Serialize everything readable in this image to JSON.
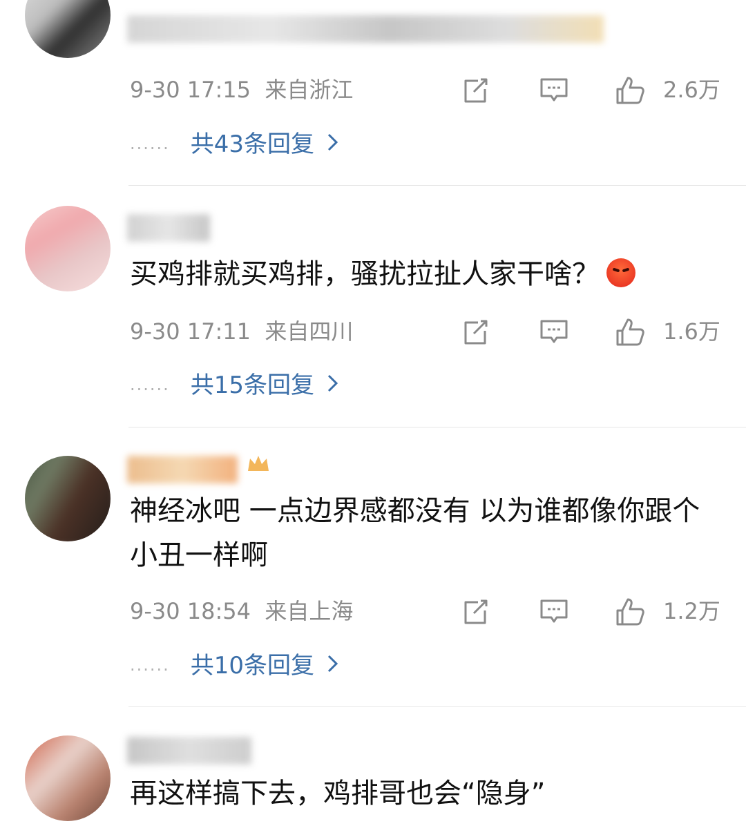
{
  "comments": [
    {
      "text": "",
      "time": "9-30 17:15",
      "location": "来自浙江",
      "likes": "2.6万",
      "replies": "共43条回复",
      "avatar_colors": [
        "#d9d9d9",
        "#9a9a9a",
        "#333333"
      ]
    },
    {
      "text": "买鸡排就买鸡排，骚扰拉扯人家干啥？",
      "time": "9-30 17:11",
      "location": "来自四川",
      "likes": "1.6万",
      "replies": "共15条回复",
      "avatar_colors": [
        "#f4b4b8",
        "#e7c7c9",
        "#f7d8d6"
      ]
    },
    {
      "text": "神经冰吧 一点边界感都没有 以为谁都像你跟个小丑一样啊",
      "time": "9-30 18:54",
      "location": "来自上海",
      "likes": "1.2万",
      "replies": "共10条回复",
      "avatar_colors": [
        "#4e5b46",
        "#6d4a3b",
        "#1f1d1b"
      ]
    },
    {
      "text": "再这样搞下去，鸡排哥也会“隐身”",
      "avatar_colors": [
        "#d35b3c",
        "#e7c8c0",
        "#7a4a3a"
      ]
    }
  ],
  "icons": {
    "forward": "forward-icon",
    "reply": "comment-icon",
    "like": "thumbs-up-icon",
    "emoji": "angry-face-emoji",
    "chevron": "chevron-right-icon",
    "more": "more-dots"
  },
  "colors": {
    "link": "#3a6ea8",
    "meta": "#8a8a8a",
    "divider": "#e6e6e6"
  }
}
